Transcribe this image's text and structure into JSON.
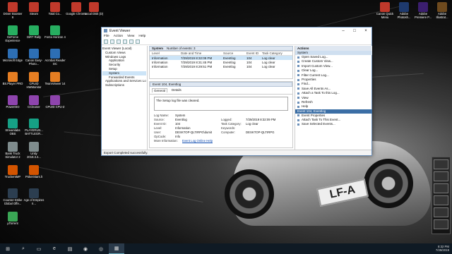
{
  "desktop": {
    "icons_col1": [
      "Driver Booster 6",
      "GeForce Experience",
      "Microsoft Edge",
      "BS.Player PRO",
      "PowerISO",
      "Streamlabs OBS",
      "Bank Truck Simulator 2",
      "TruckersMP",
      "Counter-Strike Global Offe...",
      "µTorrent"
    ],
    "icons_col2": [
      "Steam",
      "DiRT Rally",
      "Canon Easy-Photo...",
      "CPUID HWMonitor",
      "CCleaner",
      "PLAYERUN... BATTLEGR...",
      "Unity 2018.3.4...",
      "PokerStars.lt",
      "Age of Empires II..."
    ],
    "icons_col3": [
      "Total Co...",
      "Forza Horizon 4",
      "Acrobat Reader DC",
      "TeamViewer 14",
      "CPUID CPU-Z"
    ],
    "icons_col4": [
      "Google Chrome"
    ],
    "icons_col5": [
      "Local Disk (D)"
    ],
    "icons_right": [
      "Canon Quick Menu",
      "Adobe Photosh...",
      "Adobe Premiere P...",
      "Adobe Illustrat..."
    ],
    "plate_text": "LF-A"
  },
  "window": {
    "title": "Event Viewer",
    "menu": [
      "File",
      "Action",
      "View",
      "Help"
    ],
    "tree": [
      "Event Viewer (Local)",
      "Custom Views",
      "Windows Logs",
      "Application",
      "Security",
      "Setup",
      "System",
      "Forwarded Events",
      "Applications and Services Lo",
      "Subscriptions"
    ],
    "list_header": {
      "name": "System",
      "count": "Number of events: 3"
    },
    "columns": [
      "Level",
      "Date and Time",
      "Source",
      "Event ID",
      "Task Category"
    ],
    "rows": [
      {
        "level": "Information",
        "date": "7/29/2019 8:32:09 PM",
        "source": "Eventlog",
        "id": "104",
        "task": "Log clear"
      },
      {
        "level": "Information",
        "date": "7/29/2019 8:31:45 PM",
        "source": "Eventlog",
        "id": "104",
        "task": "Log clear"
      },
      {
        "level": "Information",
        "date": "7/29/2019 8:29:51 PM",
        "source": "Eventlog",
        "id": "104",
        "task": "Log clear"
      }
    ],
    "detail": {
      "title": "Event 104, Eventlog",
      "tabs": [
        "General",
        "Details"
      ],
      "message": "The Setup log file was cleared.",
      "props": [
        [
          "Log Name:",
          "System",
          "",
          ""
        ],
        [
          "Source:",
          "Eventlog",
          "Logged:",
          "7/29/2019 8:32:09 PM"
        ],
        [
          "Event ID:",
          "104",
          "Task Category:",
          "Log clear"
        ],
        [
          "Level:",
          "Information",
          "Keywords:",
          ""
        ],
        [
          "User:",
          "DESKTOP-QLTIRPG\\dumit",
          "Computer:",
          "DESKTOP-QLTIRPG"
        ],
        [
          "OpCode:",
          "Info",
          "",
          ""
        ]
      ],
      "more_info_label": "More Information:",
      "more_info_link": "Event Log Online Help"
    },
    "actions": {
      "header": "Actions",
      "section1": "System",
      "items1": [
        "Open Saved Log...",
        "Create Custom View...",
        "Import Custom View...",
        "Clear Log...",
        "Filter Current Log...",
        "Properties",
        "Find...",
        "Save All Events As...",
        "Attach a Task To this Log...",
        "View",
        "Refresh",
        "Help"
      ],
      "section2": "Event 104, Eventlog",
      "items2": [
        "Event Properties",
        "Attach Task To This Event...",
        "Save Selected Events..."
      ]
    },
    "status": "Export  Completed successfully."
  },
  "taskbar": {
    "time": "8:32 PM",
    "date": "7/29/2019"
  }
}
